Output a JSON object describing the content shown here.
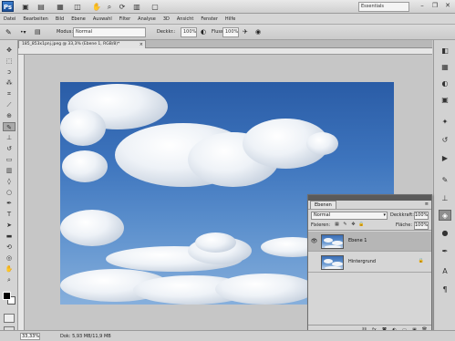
{
  "app": {
    "logo_text": "Ps",
    "workspace_name": "Essentials",
    "window_controls": [
      "minimize-icon",
      "restore-icon",
      "close-icon"
    ]
  },
  "menu": {
    "items": [
      "Datei",
      "Bearbeiten",
      "Bild",
      "Ebene",
      "Auswahl",
      "Filter",
      "Analyse",
      "3D",
      "Ansicht",
      "Fenster",
      "Hilfe"
    ]
  },
  "options_bar": {
    "modus_label": "Modus:",
    "modus_value": "Normal",
    "deckkraft_label": "Deckkr.:",
    "deckkraft_value": "100%",
    "fluss_label": "Fluss:",
    "fluss_value": "100%"
  },
  "document": {
    "tab_title": "185_853x1pnj.jpeg @ 33,3% (Ebene 1, RGB/8)*",
    "close_symbol": "×"
  },
  "status_bar": {
    "zoom": "33,33%",
    "doc_info": "Dok: 5,93 MB/11,9 MB"
  },
  "layers_panel": {
    "tab_label": "Ebenen",
    "blend_mode": "Normal",
    "opacity_label": "Deckkraft:",
    "opacity_value": "100%",
    "fix_label": "Fixieren:",
    "fill_label": "Fläche:",
    "fill_value": "100%",
    "layers": [
      {
        "name": "Ebene 1",
        "selected": true,
        "visible": true,
        "locked": false
      },
      {
        "name": "Hintergrund",
        "selected": false,
        "visible": false,
        "locked": true
      }
    ]
  },
  "colors": {
    "accent": "#2a5ca6",
    "panel_bg": "#d6d6d6",
    "workspace_bg": "#c6c6c6"
  }
}
